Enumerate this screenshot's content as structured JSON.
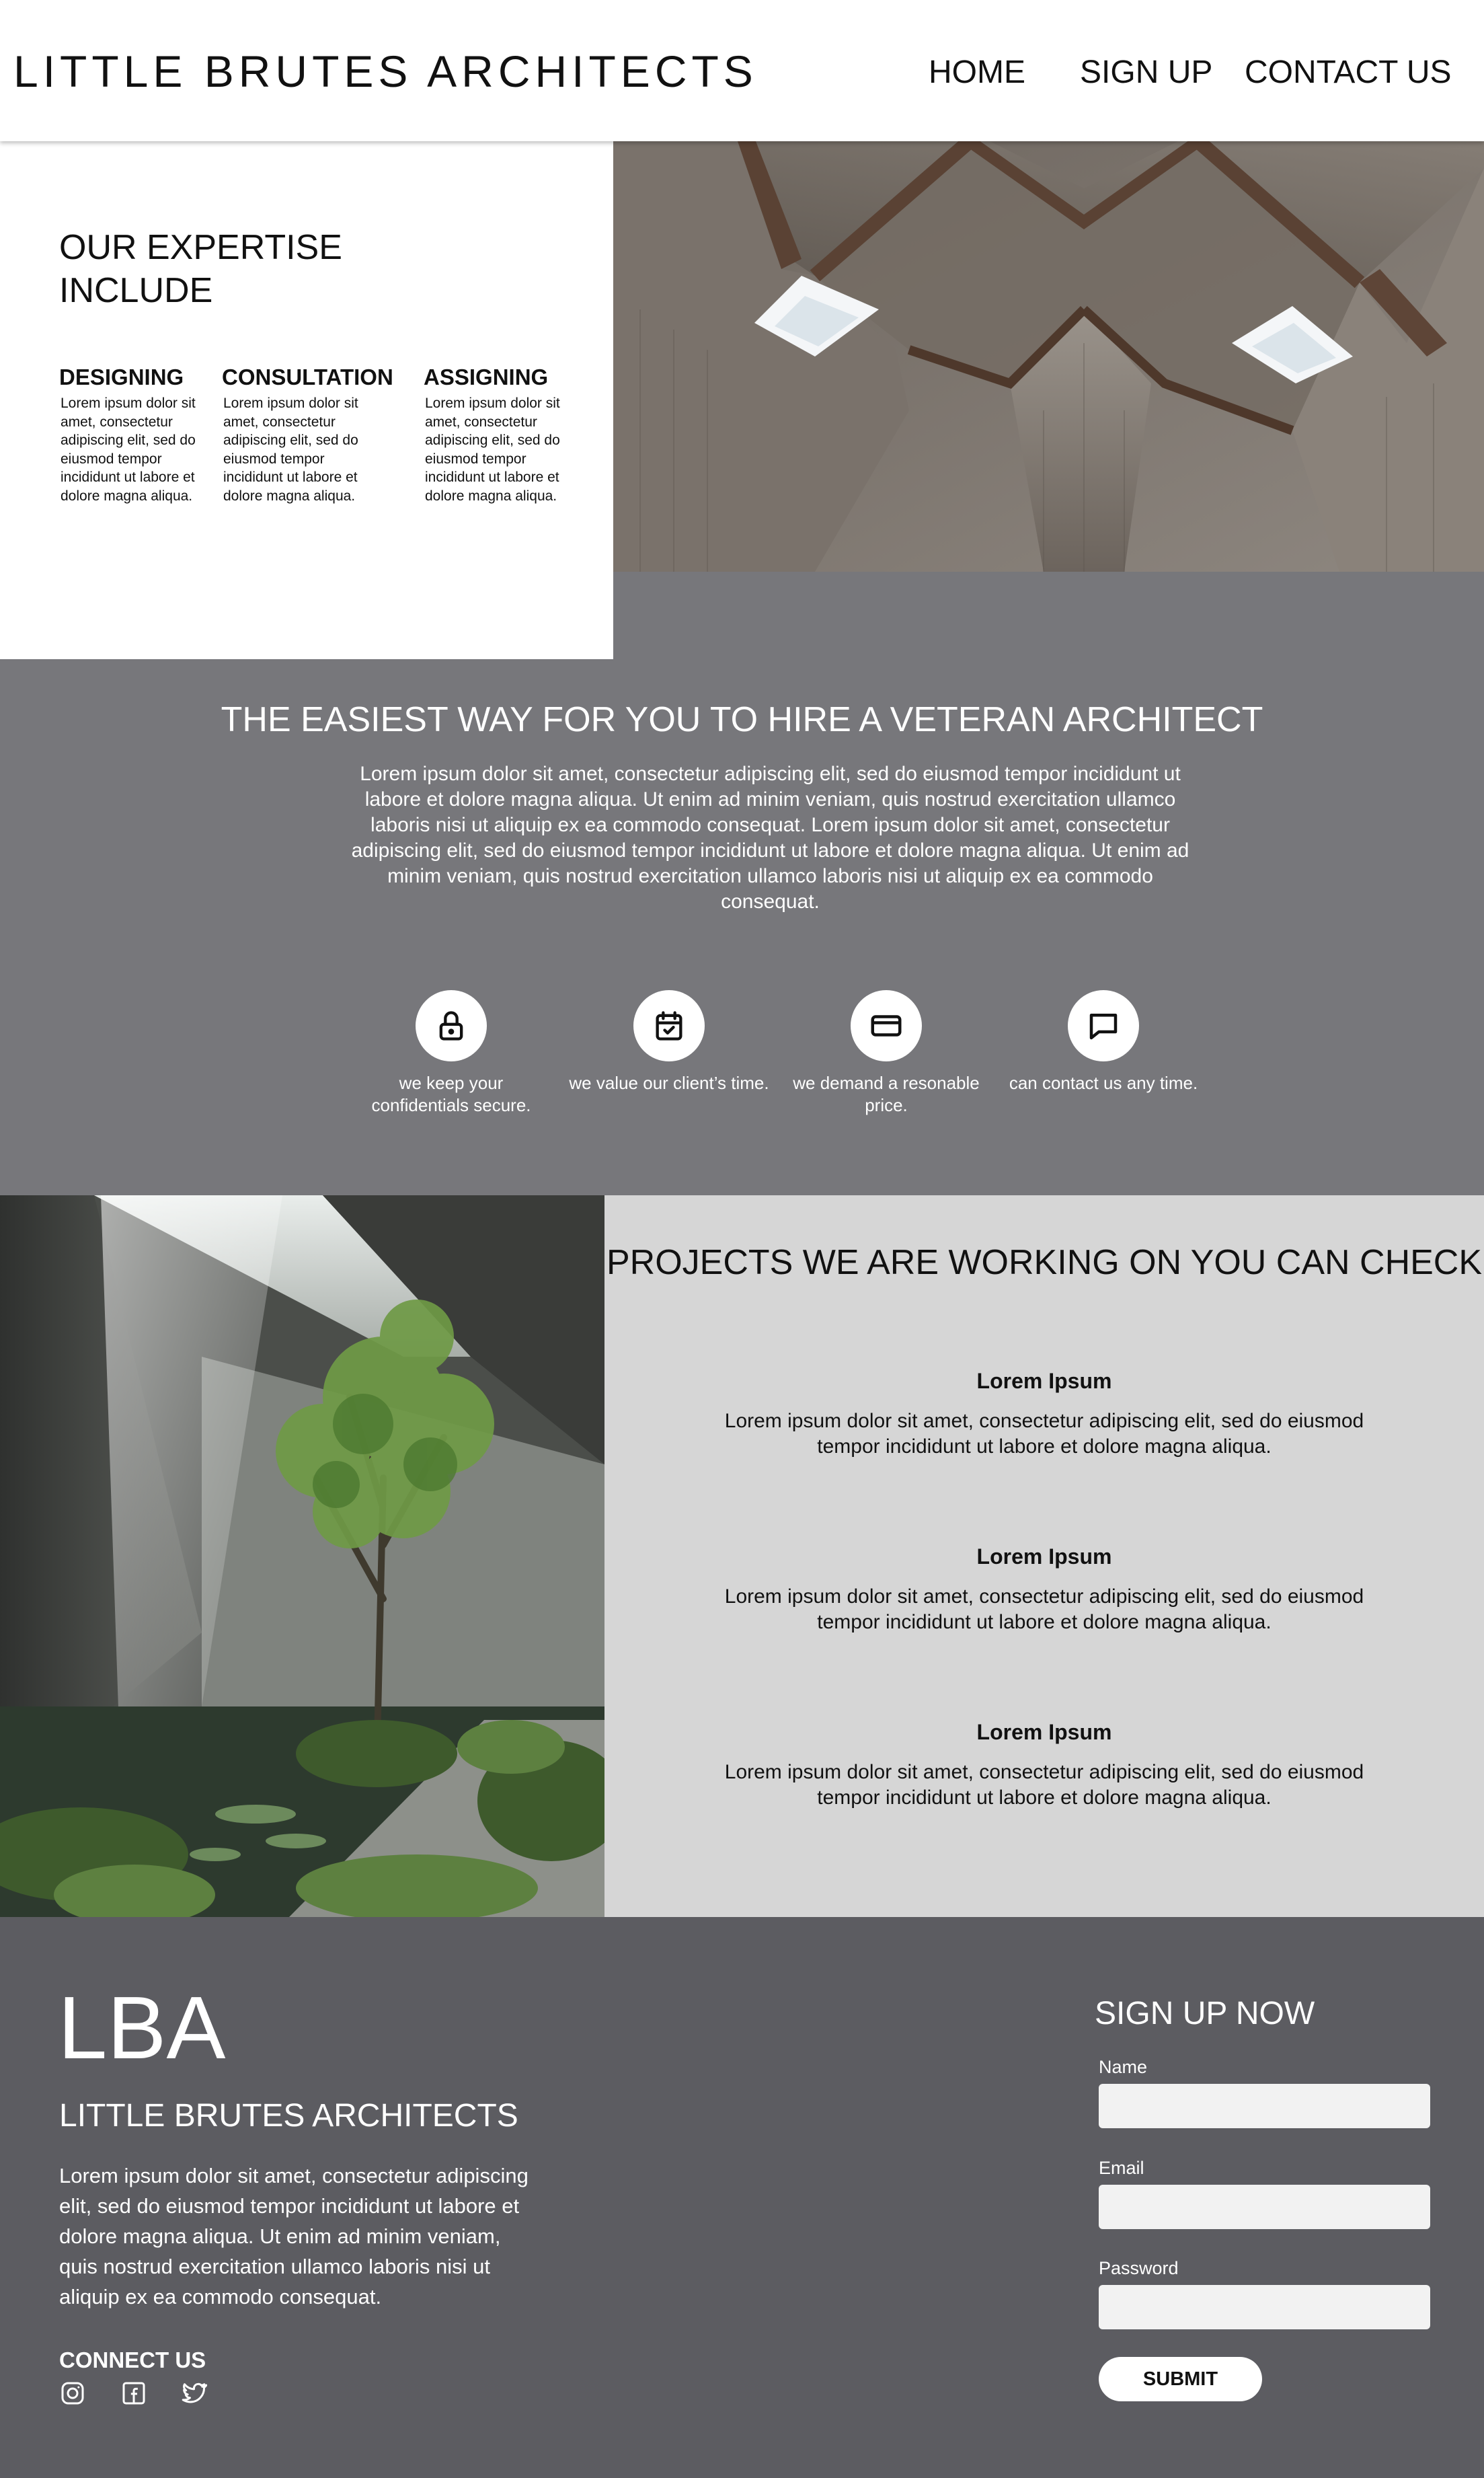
{
  "header": {
    "brand": "LITTLE BRUTES ARCHITECTS",
    "nav": {
      "home": "HOME",
      "signup": "SIGN UP",
      "contact": "CONTACT US"
    }
  },
  "expertise": {
    "title": "OUR EXPERTISE INCLUDE",
    "items": [
      {
        "title": "DESIGNING",
        "text": "Lorem ipsum dolor sit amet, consectetur adipiscing elit, sed do eiusmod tempor incididunt ut labore et dolore magna aliqua."
      },
      {
        "title": "CONSULTATION",
        "text": "Lorem ipsum dolor sit amet, consectetur adipiscing elit, sed do eiusmod tempor incididunt ut labore et dolore magna aliqua."
      },
      {
        "title": "ASSIGNING",
        "text": "Lorem ipsum dolor sit amet, consectetur adipiscing elit, sed do eiusmod tempor incididunt ut labore et dolore magna aliqua."
      }
    ]
  },
  "hire": {
    "title": "THE EASIEST WAY FOR YOU TO HIRE A VETERAN ARCHITECT",
    "text": "Lorem ipsum dolor sit amet, consectetur adipiscing elit, sed do eiusmod tempor incididunt ut labore et dolore magna aliqua. Ut enim ad minim veniam, quis nostrud exercitation ullamco laboris nisi ut aliquip ex ea commodo consequat. Lorem ipsum dolor sit amet, consectetur adipiscing elit, sed do eiusmod tempor incididunt ut labore et dolore magna aliqua. Ut enim ad minim veniam, quis nostrud exercitation ullamco laboris nisi ut aliquip ex ea commodo consequat.",
    "features": [
      {
        "icon": "lock-icon",
        "caption": "we keep your confidentials secure."
      },
      {
        "icon": "calendar-check-icon",
        "caption": "we value our client’s time."
      },
      {
        "icon": "credit-card-icon",
        "caption": "we demand a resonable price."
      },
      {
        "icon": "chat-bubble-icon",
        "caption": "can contact us any time."
      }
    ]
  },
  "projects": {
    "title": "PROJECTS WE ARE WORKING ON YOU CAN CHECK",
    "items": [
      {
        "title": "Lorem Ipsum",
        "text": "Lorem ipsum dolor sit amet, consectetur adipiscing elit, sed do eiusmod tempor incididunt ut labore et dolore magna aliqua."
      },
      {
        "title": "Lorem Ipsum",
        "text": "Lorem ipsum dolor sit amet, consectetur adipiscing elit, sed do eiusmod tempor incididunt ut labore et dolore magna aliqua."
      },
      {
        "title": "Lorem Ipsum",
        "text": "Lorem ipsum dolor sit amet, consectetur adipiscing elit, sed do eiusmod tempor incididunt ut labore et dolore magna aliqua."
      }
    ]
  },
  "footer": {
    "logo": "LBA",
    "name": "LITTLE BRUTES ARCHITECTS",
    "text": "Lorem ipsum dolor sit amet, consectetur adipiscing elit, sed do eiusmod tempor incididunt ut labore et dolore magna aliqua. Ut enim ad minim veniam, quis nostrud exercitation ullamco laboris nisi ut aliquip ex ea commodo consequat.",
    "connect_title": "CONNECT US",
    "social_icons": [
      "instagram-icon",
      "facebook-icon",
      "twitter-icon"
    ],
    "signup": {
      "title": "SIGN UP NOW",
      "name_label": "Name",
      "email_label": "Email",
      "password_label": "Password",
      "name_value": "",
      "email_value": "",
      "password_value": "",
      "submit_label": "SUBMIT"
    }
  },
  "colors": {
    "header_bg": "#ffffff",
    "hire_bg": "#77777b",
    "projects_bg": "#d6d6d6",
    "footer_bg": "#5c5c61",
    "input_bg": "#f2f2f2"
  }
}
